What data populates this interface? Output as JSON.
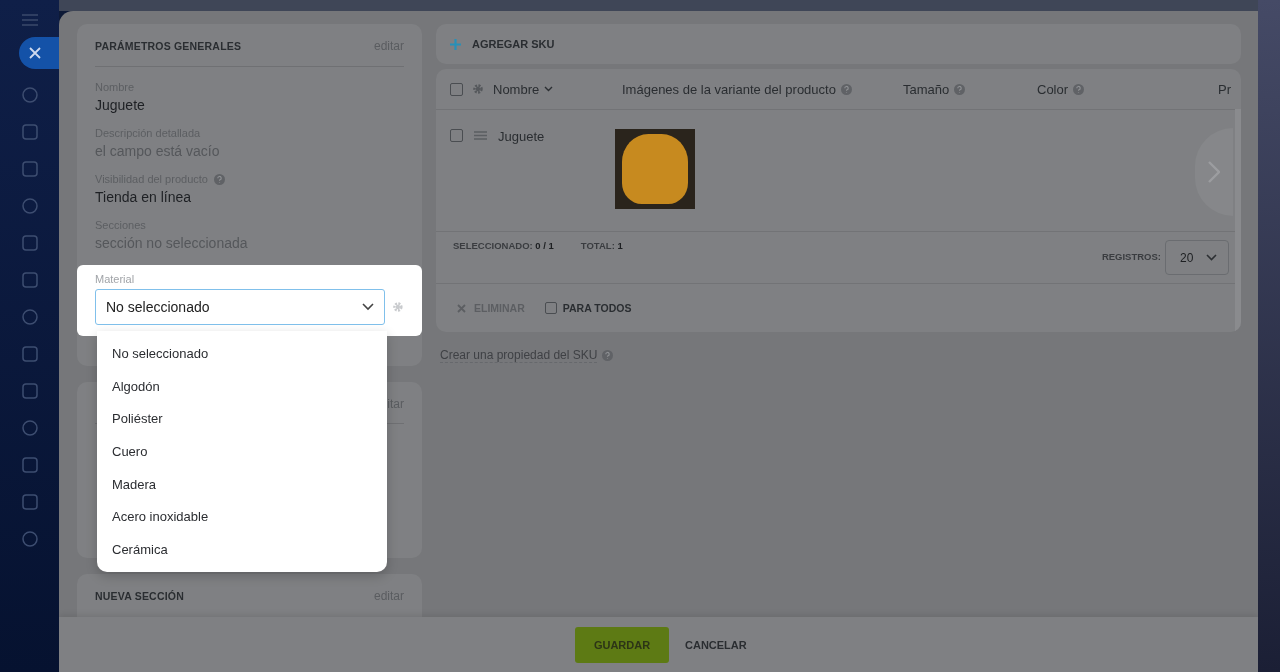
{
  "general": {
    "title": "PARÁMETROS GENERALES",
    "edit_link": "editar",
    "fields": [
      {
        "label": "Nombre",
        "value": "Juguete",
        "empty": false
      },
      {
        "label": "Descripción detallada",
        "value": "el campo está vacío",
        "empty": true
      },
      {
        "label": "Visibilidad del producto",
        "value": "Tienda en línea",
        "empty": false,
        "help": true
      },
      {
        "label": "Secciones",
        "value": "sección no seleccionada",
        "empty": true
      }
    ]
  },
  "material": {
    "label": "Material",
    "value": "No seleccionado",
    "expanded": true,
    "options": [
      {
        "label": "No seleccionado"
      },
      {
        "label": "Algodón"
      },
      {
        "label": "Poliéster"
      },
      {
        "label": "Cuero"
      },
      {
        "label": "Madera"
      },
      {
        "label": "Acero inoxidable"
      },
      {
        "label": "Cerámica"
      }
    ]
  },
  "second_card": {
    "edit_link": "itar"
  },
  "new_section": {
    "title": "NUEVA SECCIÓN",
    "edit_link": "editar"
  },
  "sku_toolbar": {
    "add_button": "AGREGAR SKU"
  },
  "table": {
    "columns": [
      {
        "label": "Nombre",
        "kind": "sort"
      },
      {
        "label": "Imágenes de la variante del producto",
        "kind": "help"
      },
      {
        "label": "Tamaño",
        "kind": "help"
      },
      {
        "label": "Color",
        "kind": "help"
      },
      {
        "label": "Pr",
        "kind": "plain"
      }
    ],
    "all_checked": false,
    "rows": [
      {
        "name": "Juguete",
        "checked": false
      }
    ],
    "selected_label": "SELECCIONADO:",
    "selected_value": "0 / 1",
    "total_label": "TOTAL:",
    "total_value": "1",
    "records_label": "REGISTROS:",
    "records_value": "20"
  },
  "actions": {
    "delete": "ELIMINAR",
    "delete_disabled": true,
    "for_all": "PARA TODOS",
    "for_all_checked": false
  },
  "create_property_link": "Crear una propiedad del SKU",
  "buttons": {
    "save": "GUARDAR",
    "cancel": "CANCELAR"
  }
}
